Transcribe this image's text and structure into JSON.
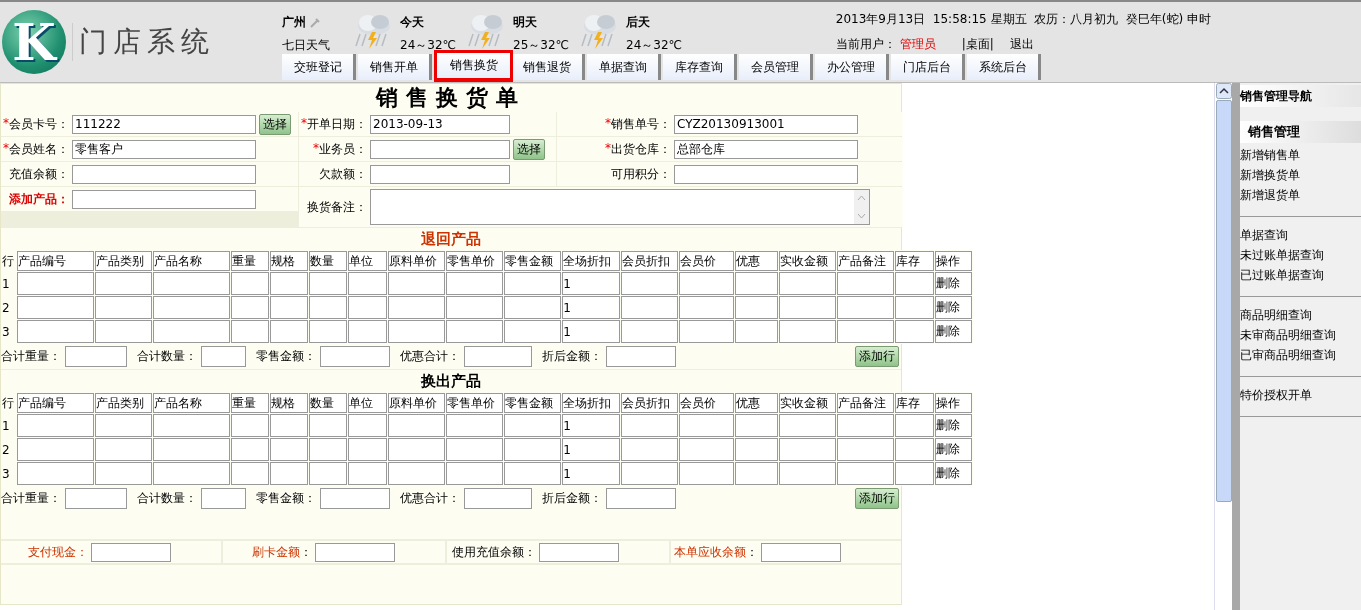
{
  "header": {
    "logo_letter": "K",
    "logo_text": "门店系统",
    "city": "广州",
    "weather_label": "七日天气",
    "forecast": [
      {
        "day": "今天",
        "temp": "24～32℃"
      },
      {
        "day": "明天",
        "temp": "25～32℃"
      },
      {
        "day": "后天",
        "temp": "24～32℃"
      }
    ],
    "datetime": "2013年9月13日  15:58:15 星期五  农历：八月初九  癸巳年(蛇) 申时",
    "user_label": "当前用户：",
    "user": "管理员",
    "links": [
      "|桌面|",
      "退出"
    ]
  },
  "nav_tabs": [
    {
      "label": "交班登记",
      "selected": false
    },
    {
      "label": "销售开单",
      "selected": false
    },
    {
      "label": "销售换货",
      "selected": true
    },
    {
      "label": "销售退货",
      "selected": false
    },
    {
      "label": "单据查询",
      "selected": false
    },
    {
      "label": "库存查询",
      "selected": false
    },
    {
      "label": "会员管理",
      "selected": false
    },
    {
      "label": "办公管理",
      "selected": false
    },
    {
      "label": "门店后台",
      "selected": false
    },
    {
      "label": "系统后台",
      "selected": false
    }
  ],
  "form": {
    "title": "销售换货单",
    "fields": [
      {
        "kind": "input",
        "mark": "*",
        "label": "会员卡号：",
        "value": "111222",
        "button": "选择"
      },
      {
        "kind": "input",
        "mark": "*",
        "label": "开单日期：",
        "value": "2013-09-13"
      },
      {
        "kind": "input",
        "mark": "*",
        "label": "销售单号：",
        "value": "CYZ20130913001"
      },
      {
        "kind": "input",
        "mark": "*",
        "label": "会员姓名：",
        "value": "零售客户"
      },
      {
        "kind": "input",
        "mark": "*",
        "label": "业务员：",
        "button": "选择"
      },
      {
        "kind": "input",
        "mark": "*",
        "label": "出货仓库：",
        "value": "总部仓库"
      },
      {
        "kind": "input",
        "label": "充值余额："
      },
      {
        "kind": "input",
        "label": "欠款额："
      },
      {
        "kind": "input",
        "label": "可用积分："
      },
      {
        "kind": "input",
        "label": "添加产品：",
        "emphasis": true
      },
      {
        "kind": "textarea",
        "label": "换货备注："
      }
    ],
    "sections": [
      {
        "title": "退回产品",
        "color": "#cc3300",
        "columns": [
          "行",
          "产品编号",
          "产品类别",
          "产品名称",
          "重量",
          "规格",
          "数量",
          "单位",
          "原料单价",
          "零售单价",
          "零售金额",
          "全场折扣",
          "会员折扣",
          "会员价",
          "优惠",
          "实收金额",
          "产品备注",
          "库存",
          "操作"
        ],
        "rows": [
          {
            "row_no": "1",
            "overall_discount": "1",
            "action": "删除"
          },
          {
            "row_no": "2",
            "overall_discount": "1",
            "action": "删除"
          },
          {
            "row_no": "3",
            "overall_discount": "1",
            "action": "删除"
          }
        ],
        "totals": [
          "合计重量：",
          "合计数量：",
          "零售金额：",
          "优惠合计：",
          "折后金额："
        ],
        "add_button": "添加行"
      },
      {
        "title": "换出产品",
        "color": "#000000",
        "columns": [
          "行",
          "产品编号",
          "产品类别",
          "产品名称",
          "重量",
          "规格",
          "数量",
          "单位",
          "原料单价",
          "零售单价",
          "零售金额",
          "全场折扣",
          "会员折扣",
          "会员价",
          "优惠",
          "实收金额",
          "产品备注",
          "库存",
          "操作"
        ],
        "rows": [
          {
            "row_no": "1",
            "overall_discount": "1",
            "action": "删除"
          },
          {
            "row_no": "2",
            "overall_discount": "1",
            "action": "删除"
          },
          {
            "row_no": "3",
            "overall_discount": "1",
            "action": "删除"
          }
        ],
        "totals": [
          "合计重量：",
          "合计数量：",
          "零售金额：",
          "优惠合计：",
          "折后金额："
        ],
        "add_button": "添加行"
      }
    ],
    "payments": [
      {
        "label": "支付现金：",
        "emphasis": true
      },
      {
        "label": "刷卡金额",
        "emphasis": true
      },
      {
        "label": "使用充值余额：",
        "emphasis": false
      },
      {
        "label": "本单应收余额",
        "emphasis": true
      }
    ],
    "payment_colon": "："
  },
  "sidebar": {
    "title": "销售管理导航",
    "groups": [
      {
        "heading": "销售管理",
        "items": [
          "新增销售单",
          "新增换货单",
          "新增退货单"
        ]
      },
      {
        "items": [
          "单据查询",
          "未过账单据查询",
          "已过账单据查询"
        ]
      },
      {
        "items": [
          "商品明细查询",
          "未审商品明细查询",
          "已审商品明细查询"
        ]
      },
      {
        "items": [
          "特价授权开单"
        ]
      }
    ]
  }
}
